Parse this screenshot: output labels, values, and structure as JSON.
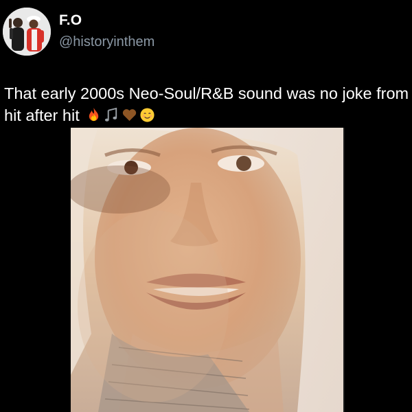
{
  "author": {
    "display_name": "F.O",
    "handle": "@historyinthem",
    "avatar_icon": "profile-photo-icon"
  },
  "tweet": {
    "text": "That early 2000s Neo-Soul/R&B sound was no joke from hit after hit",
    "emojis": [
      "fire-emoji",
      "musical-notes-emoji",
      "brown-heart-emoji",
      "relieved-face-emoji"
    ]
  },
  "media": {
    "type": "video-still",
    "icon": "video-thumbnail-icon"
  },
  "colors": {
    "background": "#000000",
    "text_primary": "#ffffff",
    "text_secondary": "#8b98a5"
  }
}
